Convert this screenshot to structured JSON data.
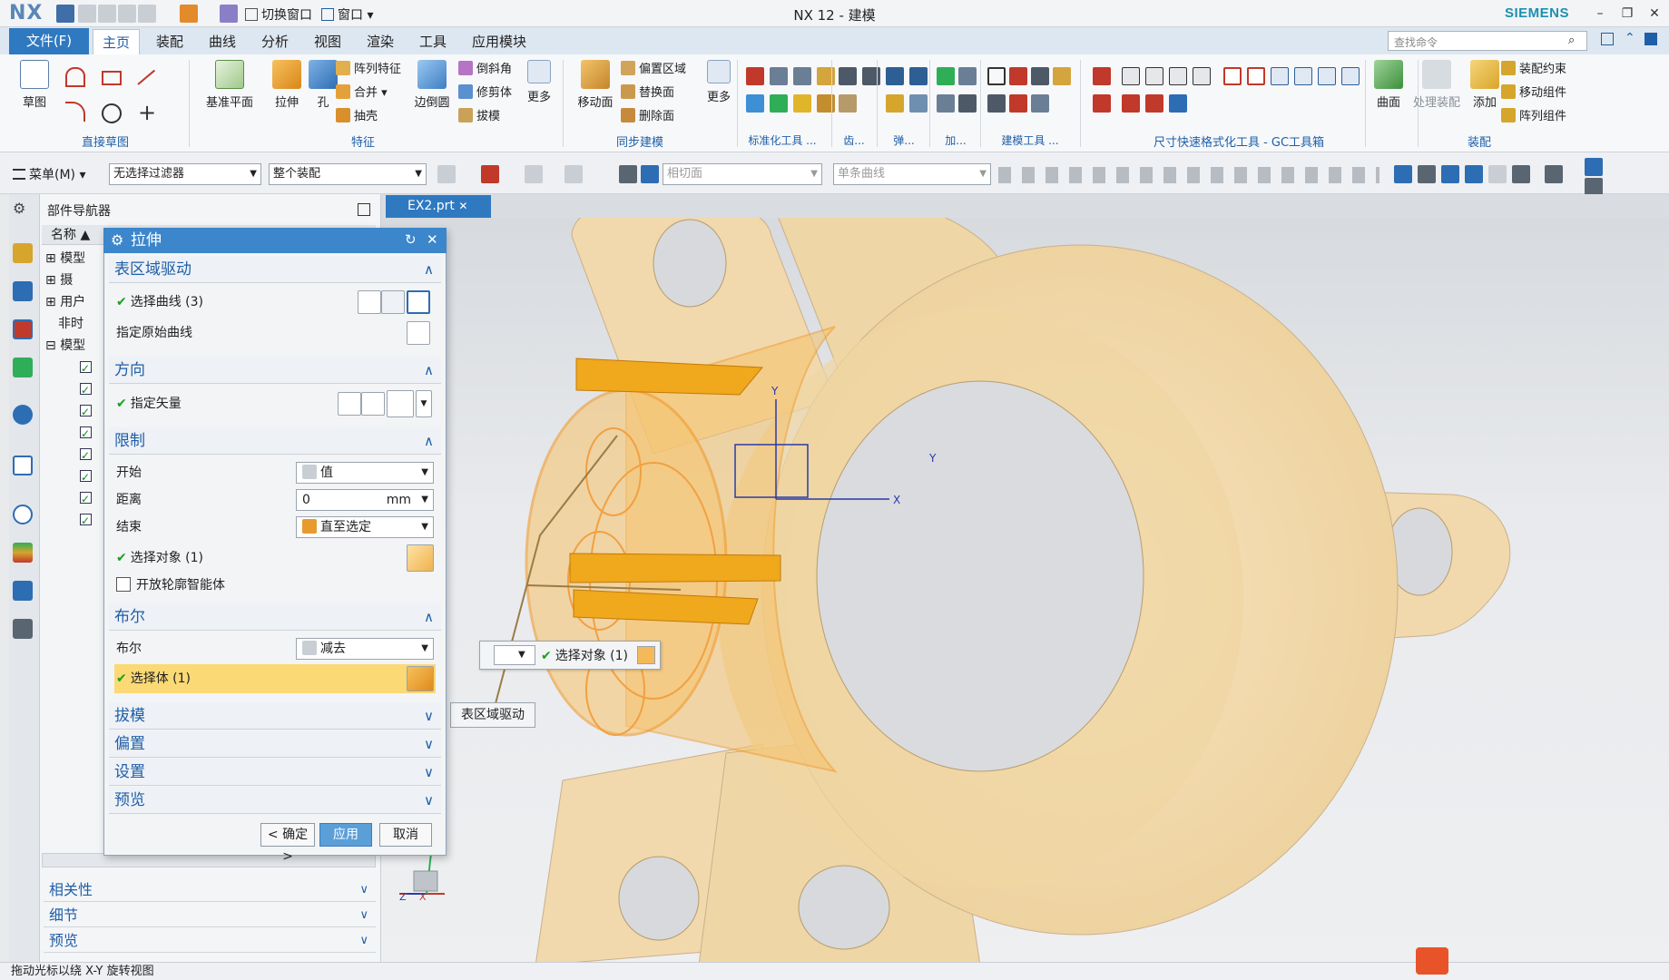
{
  "titlebar": {
    "logo": "NX",
    "title": "NX 12 - 建模",
    "brand": "SIEMENS",
    "switch_window": "切换窗口",
    "window": "窗口"
  },
  "menu": {
    "file": "文件(F)",
    "tabs": [
      "主页",
      "装配",
      "曲线",
      "分析",
      "视图",
      "渲染",
      "工具",
      "应用模块"
    ],
    "search_placeholder": "查找命令"
  },
  "ribbon": {
    "sketch": "草图",
    "datum_plane": "基准平面",
    "extrude": "拉伸",
    "hole": "孔",
    "pattern_feature": "阵列特征",
    "unite": "合并",
    "shell": "抽壳",
    "edge_blend": "边倒圆",
    "chamfer": "倒斜角",
    "trim_body": "修剪体",
    "draft": "拔模",
    "more": "更多",
    "move_face": "移动面",
    "offset_region": "偏置区域",
    "replace_face": "替换面",
    "delete_face": "删除面",
    "more2": "更多",
    "surface": "曲面",
    "process_assembly": "处理装配",
    "add": "添加",
    "assembly_constraints": "装配约束",
    "move_component": "移动组件",
    "pattern_component": "阵列组件",
    "groups": {
      "direct_sketch": "直接草图",
      "feature": "特征",
      "sync_model": "同步建模",
      "std_tools": "标准化工具 ...",
      "gear": "齿...",
      "spring": "弹...",
      "add_short": "加...",
      "build_tools": "建模工具 ...",
      "dim_tools": "尺寸快速格式化工具 - GC工具箱",
      "assembly": "装配"
    }
  },
  "toolbar2": {
    "menu": "菜单(M)",
    "filter": "无选择过滤器",
    "scope": "整个装配",
    "tangent_face": "相切面",
    "single_curve": "单条曲线"
  },
  "navigator": {
    "title": "部件导航器",
    "col_name": "名称",
    "rows": [
      "模型",
      "摄",
      "用户",
      "非时",
      "模型"
    ],
    "sections": [
      "相关性",
      "细节",
      "预览"
    ]
  },
  "doc_tab": "EX2.prt",
  "dialog": {
    "title": "拉伸",
    "sec_region": "表区域驱动",
    "select_curve": "选择曲线 (3)",
    "specify_origin_curve": "指定原始曲线",
    "sec_direction": "方向",
    "specify_vector": "指定矢量",
    "sec_limits": "限制",
    "start": "开始",
    "start_value": "值",
    "distance": "距离",
    "distance_value": "0",
    "unit": "mm",
    "end": "结束",
    "end_value": "直至选定",
    "select_object": "选择对象 (1)",
    "open_profile": "开放轮廓智能体",
    "sec_boolean": "布尔",
    "boolean": "布尔",
    "boolean_value": "减去",
    "select_body": "选择体 (1)",
    "sec_draft": "拔模",
    "sec_offset": "偏置",
    "sec_settings": "设置",
    "sec_preview": "预览",
    "ok": "< 确定 >",
    "apply": "应用",
    "cancel": "取消"
  },
  "viewport": {
    "float_select": "选择对象 (1)",
    "float_label": "表区域驱动",
    "axis_x": "X",
    "axis_y": "Y",
    "axis_z": "Z"
  },
  "status": "拖动光标以绕 X-Y 旋转视图"
}
